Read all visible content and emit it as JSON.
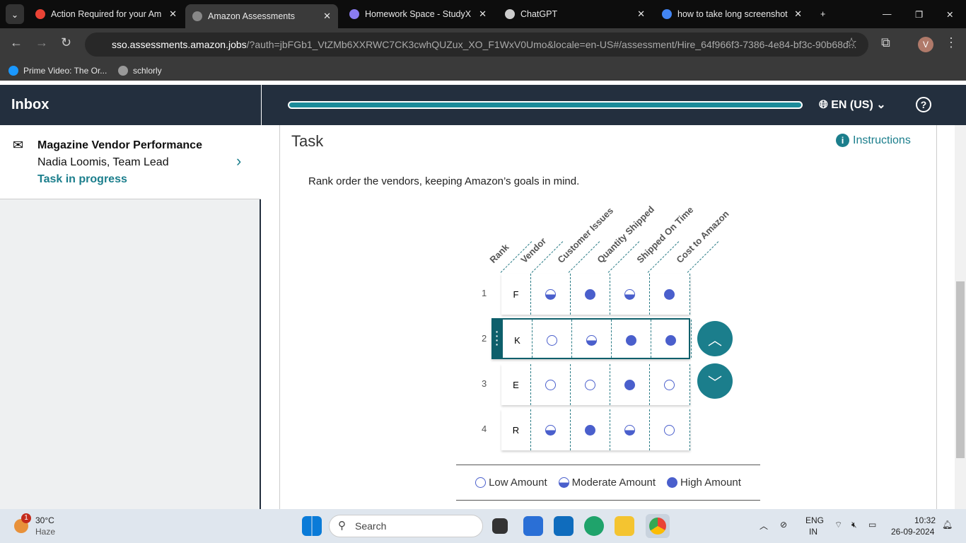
{
  "browser": {
    "tabs": [
      {
        "title": "Action Required for your Am",
        "icon": "gmail-icon",
        "color": "#ea4335"
      },
      {
        "title": "Amazon Assessments",
        "icon": "globe-icon",
        "color": "#888",
        "active": true
      },
      {
        "title": "Homework Space - StudyX",
        "icon": "studyx-icon",
        "color": "#8a7cf0"
      },
      {
        "title": "ChatGPT",
        "icon": "chatgpt-icon",
        "color": "#ccc"
      },
      {
        "title": "how to take long screenshot",
        "icon": "google-icon",
        "color": "#4285f4"
      }
    ],
    "url_host": "sso.assessments.amazon.jobs",
    "url_rest": "/?auth=jbFGb1_VtZMb6XXRWC7CK3cwhQUZux_XO_F1WxV0Umo&locale=en-US#/assessment/Hire_64f966f3-7386-4e84-bf3c-90b68d...",
    "profile_initial": "V",
    "bookmarks": [
      "Prime Video: The Or...",
      "schlorly"
    ]
  },
  "sidebar": {
    "title": "Inbox",
    "item": {
      "title": "Magazine Vendor Performance",
      "from": "Nadia Loomis, Team Lead",
      "status": "Task in progress"
    }
  },
  "header": {
    "language": "EN (US)",
    "progress_percent": 100
  },
  "task": {
    "title": "Task",
    "instructions_label": "Instructions",
    "prompt": "Rank order the vendors, keeping Amazon’s goals in mind.",
    "columns": [
      "Rank",
      "Vendor",
      "Customer Issues",
      "Quantity Shipped",
      "Shipped On Time",
      "Cost to Amazon"
    ],
    "rows": [
      {
        "rank": "1",
        "vendor": "F",
        "values": [
          "moderate",
          "high",
          "moderate",
          "high"
        ]
      },
      {
        "rank": "2",
        "vendor": "K",
        "values": [
          "low",
          "moderate",
          "high",
          "high"
        ],
        "selected": true
      },
      {
        "rank": "3",
        "vendor": "E",
        "values": [
          "low",
          "low",
          "high",
          "low"
        ]
      },
      {
        "rank": "4",
        "vendor": "R",
        "values": [
          "moderate",
          "high",
          "moderate",
          "low"
        ]
      }
    ],
    "legend": [
      {
        "level": "low",
        "label": "Low Amount"
      },
      {
        "level": "moderate",
        "label": "Moderate Amount"
      },
      {
        "level": "high",
        "label": "High Amount"
      }
    ],
    "colors": {
      "accent": "#1b7e8c",
      "dot": "#4a5fcc"
    }
  },
  "taskbar": {
    "weather_temp": "30°C",
    "weather_desc": "Haze",
    "weather_badge": "1",
    "search_placeholder": "Search",
    "lang_line1": "ENG",
    "lang_line2": "IN",
    "time": "10:32",
    "date": "26-09-2024"
  }
}
